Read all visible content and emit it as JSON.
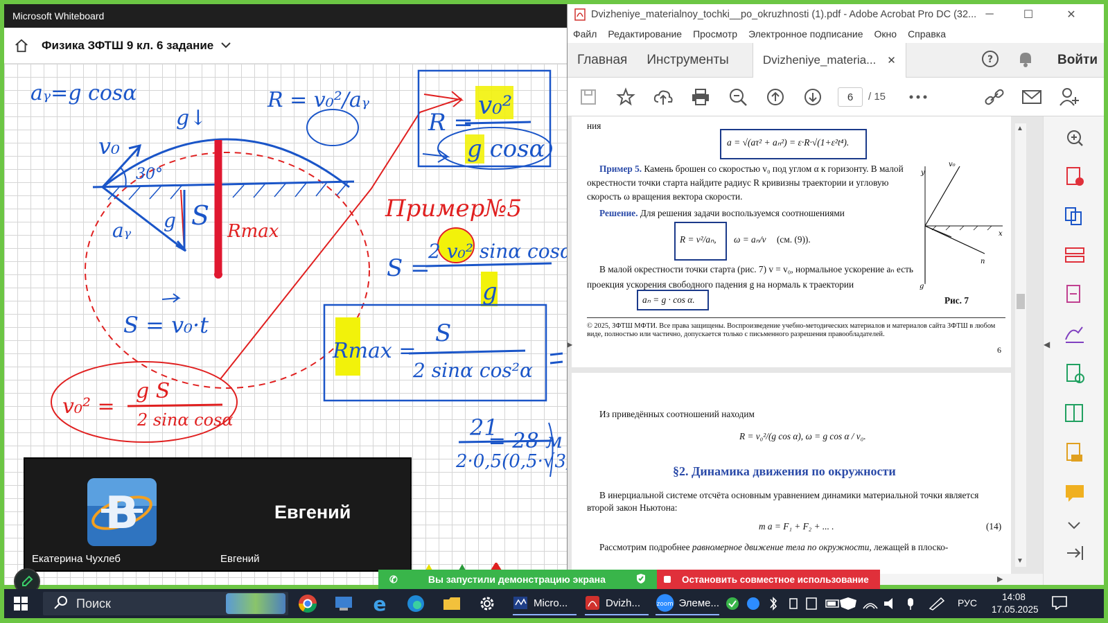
{
  "whiteboard": {
    "window_title": "Microsoft Whiteboard",
    "board_title": "Физика ЗФТШ 9 кл. 6 задание",
    "video": {
      "big_name": "Евгений",
      "left_label": "Екатерина Чухлеб",
      "right_label": "Евгений"
    },
    "ink": {
      "ay_def": "aᵧ=g cosα",
      "r_def": "R = v₀²/aᵧ",
      "g_arrow": "g↓",
      "v0": "v₀",
      "angle": "30°",
      "ay_label": "aᵧ",
      "g_vec": "g",
      "s_label": "S",
      "rmax_label": "Rmax",
      "r_box_r": "R =",
      "r_box_num": "v₀²",
      "r_box_den": "g cosα",
      "example": "Пример№5",
      "s_eq_lhs": "S =",
      "s_eq_num": "2 v₀² sinα cosα",
      "s_eq_den": "g",
      "s_vt": "S = v₀·t",
      "rmax_box_lhs": "Rmax =",
      "rmax_box_num": "S",
      "rmax_box_den": "2 sinα cos²α",
      "v0sq_lhs": "v₀² =",
      "v0sq_num": "g S",
      "v0sq_den": "2 sinα cosα",
      "result_num": "21",
      "result_den": "2·0,5(0,5·√3)",
      "result_val": "= 28 м"
    }
  },
  "acrobat": {
    "window_title": "Dvizheniye_materialnoy_tochki__po_okruzhnosti (1).pdf - Adobe Acrobat Pro DC (32...",
    "menu": [
      "Файл",
      "Редактирование",
      "Просмотр",
      "Электронное подписание",
      "Окно",
      "Справка"
    ],
    "tabs": {
      "home": "Главная",
      "tools": "Инструменты",
      "doc": "Dvizheniye_materia..."
    },
    "signin": "Войти",
    "page_current": "6",
    "page_total": "/ 15",
    "page6": {
      "top_fragment": "ния",
      "formula_a": "a = √(aτ² + aₙ²) = ε·R·√(1+ε²t⁴).",
      "example_label": "Пример 5.",
      "example_text": "Камень брошен со скоростью v₀ под углом α к горизонту. В малой окрестности точки старта найдите радиус R кривизны траектории и угловую скорость ω вращения вектора скорости.",
      "solution_label": "Решение.",
      "solution_text": "Для решения задачи воспользуемся соотношениями",
      "formula_r": "R = v²/aₙ,",
      "formula_w": "ω = aₙ/v",
      "see": "(см. (9)).",
      "para2": "В малой окрестности точки старта (рис. 7) v = v₀, нормальное ускорение aₙ есть проекция ускорения свободного падения g на нормаль к траектории",
      "formula_an": "aₙ = g · cos α.",
      "fig_caption": "Рис. 7",
      "copyright": "© 2025, ЗФТШ МФТИ. Все права защищены. Воспроизведение учебно-методических материалов и материалов сайта ЗФТШ в любом виде, полностью или частично, допускается только с письменного разрешения правообладателей.",
      "page_no": "6"
    },
    "page7": {
      "intro": "Из приведённых соотношений находим",
      "formula": "R = v₀²/(g cos α),   ω = g cos α / v₀.",
      "section": "§2. Динамика движения по окружности",
      "para": "В инерциальной системе отсчёта основным уравнением динамики материальной точки является второй закон Ньютона:",
      "newton": "m a = F₁ + F₂ + ... .",
      "eq_no": "(14)",
      "para_last_a": "Рассмотрим подробнее",
      "para_last_i": "равномерное движение тела по окружности,",
      "para_last_b": "лежащей в плоско-"
    }
  },
  "share": {
    "running": "Вы запустили демонстрацию экрана",
    "stop": "Остановить совместное использование"
  },
  "taskbar": {
    "search": "Поиск",
    "apps": [
      "Micro...",
      "Dvizh...",
      "Элеме..."
    ],
    "lang": "РУС",
    "time": "14:08",
    "date": "17.05.2025"
  },
  "colors": {
    "ink_blue": "#1a55c8",
    "ink_red": "#e02020",
    "highlight": "#f2f20a",
    "share_green": "#39b54a",
    "stop_red": "#e0303a",
    "bg_green": "#6cc644"
  }
}
